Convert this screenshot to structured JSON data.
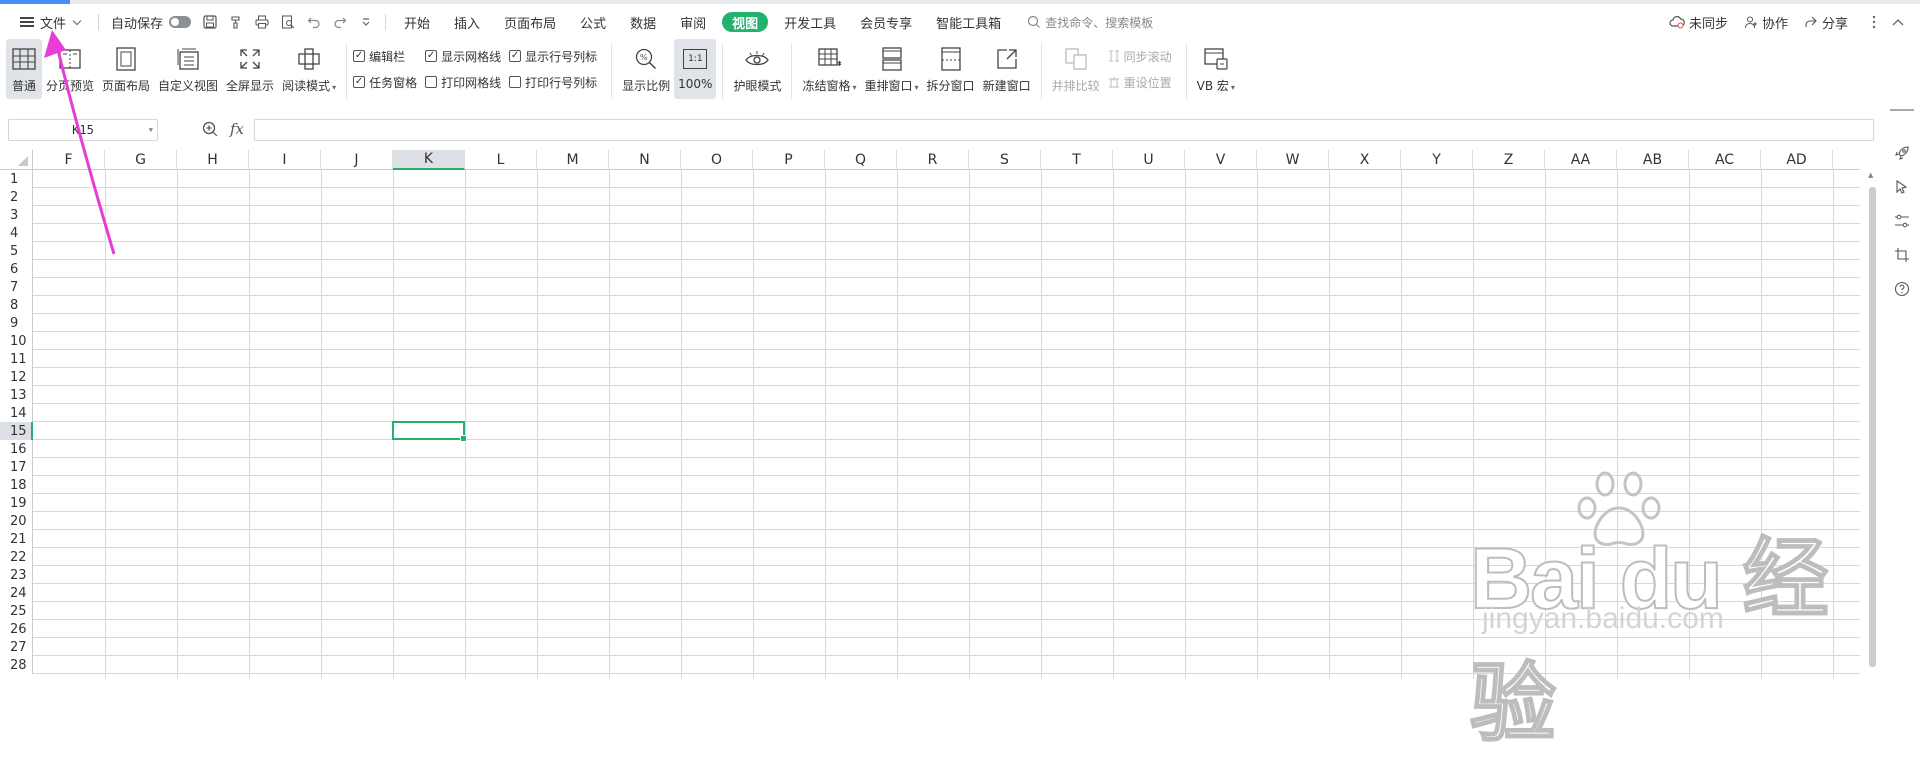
{
  "menubar": {
    "file_label": "文件",
    "autosave_label": "自动保存",
    "tabs": [
      "开始",
      "插入",
      "页面布局",
      "公式",
      "数据",
      "审阅",
      "视图",
      "开发工具",
      "会员专享",
      "智能工具箱"
    ],
    "active_tab": "视图",
    "search_placeholder": "查找命令、搜索模板",
    "right": {
      "sync": "未同步",
      "collab": "协作",
      "share": "分享"
    }
  },
  "ribbon": {
    "normal": "普通",
    "page_break": "分页预览",
    "page_layout": "页面布局",
    "custom_view": "自定义视图",
    "fullscreen": "全屏显示",
    "reading_mode": "阅读模式",
    "checks": {
      "formula_bar": {
        "label": "编辑栏",
        "checked": true
      },
      "task_pane": {
        "label": "任务窗格",
        "checked": true
      },
      "show_gridlines": {
        "label": "显示网格线",
        "checked": true
      },
      "print_gridlines": {
        "label": "打印网格线",
        "checked": false
      },
      "show_headings": {
        "label": "显示行号列标",
        "checked": true
      },
      "print_headings": {
        "label": "打印行号列标",
        "checked": false
      }
    },
    "zoom": "显示比例",
    "zoom_100": "100%",
    "zoom_100_icon": "1:1",
    "eye_mode": "护眼模式",
    "freeze": "冻结窗格",
    "rearrange": "重排窗口",
    "split": "拆分窗口",
    "new_window": "新建窗口",
    "side_by_side": "并排比较",
    "sync_scroll": "同步滚动",
    "reset_position": "重设位置",
    "macro": "VB 宏"
  },
  "formula_bar": {
    "name_box": "K15",
    "fx": "fx",
    "value": ""
  },
  "sheet": {
    "columns": [
      "F",
      "G",
      "H",
      "I",
      "J",
      "K",
      "L",
      "M",
      "N",
      "O",
      "P",
      "Q",
      "R",
      "S",
      "T",
      "U",
      "V",
      "W",
      "X",
      "Y",
      "Z",
      "AA",
      "AB",
      "AC",
      "AD"
    ],
    "rows": [
      "1",
      "2",
      "3",
      "4",
      "5",
      "6",
      "7",
      "8",
      "9",
      "10",
      "11",
      "12",
      "13",
      "14",
      "15",
      "16",
      "17",
      "18",
      "19",
      "20",
      "21",
      "22",
      "23",
      "24",
      "25",
      "26",
      "27",
      "28"
    ],
    "selected_column": "K",
    "selected_row": "15"
  },
  "watermark": {
    "brand": "Bai du 经验",
    "url": "jingyan.baidu.com"
  },
  "colors": {
    "accent": "#23b26d",
    "arrow": "#e83cd6",
    "progress": "#4a8df8"
  }
}
